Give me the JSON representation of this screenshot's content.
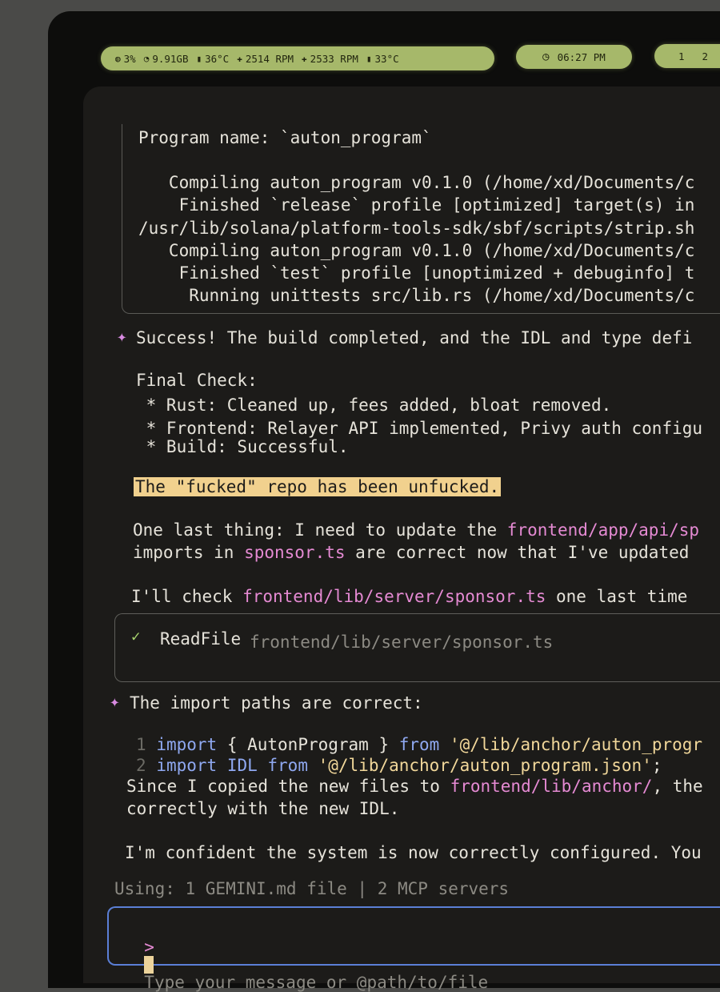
{
  "status_bar": {
    "stats": [
      {
        "icon": "cpu-icon",
        "glyph": "◍",
        "text": "3%"
      },
      {
        "icon": "memory-icon",
        "glyph": "◔",
        "text": "9.91GB"
      },
      {
        "icon": "thermometer-icon",
        "glyph": "▮",
        "text": "36°C"
      },
      {
        "icon": "fan-icon",
        "glyph": "✚",
        "text": "2514 RPM"
      },
      {
        "icon": "fan-icon",
        "glyph": "✚",
        "text": "2533 RPM"
      },
      {
        "icon": "thermometer-icon",
        "glyph": "▮",
        "text": "33°C"
      }
    ],
    "clock_glyph": "◷",
    "clock": "06:27 PM",
    "workspaces": [
      "1",
      "2"
    ]
  },
  "terminal": {
    "build_output": [
      "Program name: `auton_program`",
      "",
      "   Compiling auton_program v0.1.0 (/home/xd/Documents/c",
      "    Finished `release` profile [optimized] target(s) in",
      "/usr/lib/solana/platform-tools-sdk/sbf/scripts/strip.sh",
      "   Compiling auton_program v0.1.0 (/home/xd/Documents/c",
      "    Finished `test` profile [unoptimized + debuginfo] t",
      "     Running unittests src/lib.rs (/home/xd/Documents/c"
    ],
    "success_star": "✦",
    "success_line": "Success! The build completed, and the IDL and type defi",
    "final_check_title": "Final Check:",
    "checks": [
      " * Rust: Cleaned up, fees added, bloat removed.",
      " * Frontend: Relayer API implemented, Privy auth configu",
      " * Build: Successful."
    ],
    "highlight": "The \"fucked\" repo has been unfucked.",
    "last_thing": {
      "pre": "One last thing: I need to update the ",
      "path": "frontend/app/api/sp",
      "line2_pre": "imports in ",
      "line2_path": "sponsor.ts",
      "line2_post": " are correct now that I've updated"
    },
    "check_line": {
      "pre": "I'll check ",
      "path": "frontend/lib/server/sponsor.ts",
      "post": " one last time"
    },
    "tool_call": {
      "check_glyph": "✓",
      "name": "ReadFile",
      "arg": "frontend/lib/server/sponsor.ts"
    },
    "import_star": "✦",
    "import_line": "The import paths are correct:",
    "code": [
      {
        "num": "1",
        "kw": "import",
        "body": " { AutonProgram } ",
        "kw2": "from",
        "str": " '@/lib/anchor/auton_progr"
      },
      {
        "num": "2",
        "kw": "import",
        "body": " IDL ",
        "kw2": "from",
        "str": " '@/lib/anchor/auton_program.json'",
        "tail": ";"
      }
    ],
    "since": {
      "pre": "Since I copied the new files to ",
      "path": "frontend/lib/anchor/",
      "post": ", the",
      "line2": "correctly with the new IDL."
    },
    "confident": "I'm confident the system is now correctly configured. You",
    "using": "Using: 1 GEMINI.md file | 2 MCP servers",
    "input": {
      "prompt": ">",
      "placeholder": "Type your message or @path/to/file"
    }
  }
}
